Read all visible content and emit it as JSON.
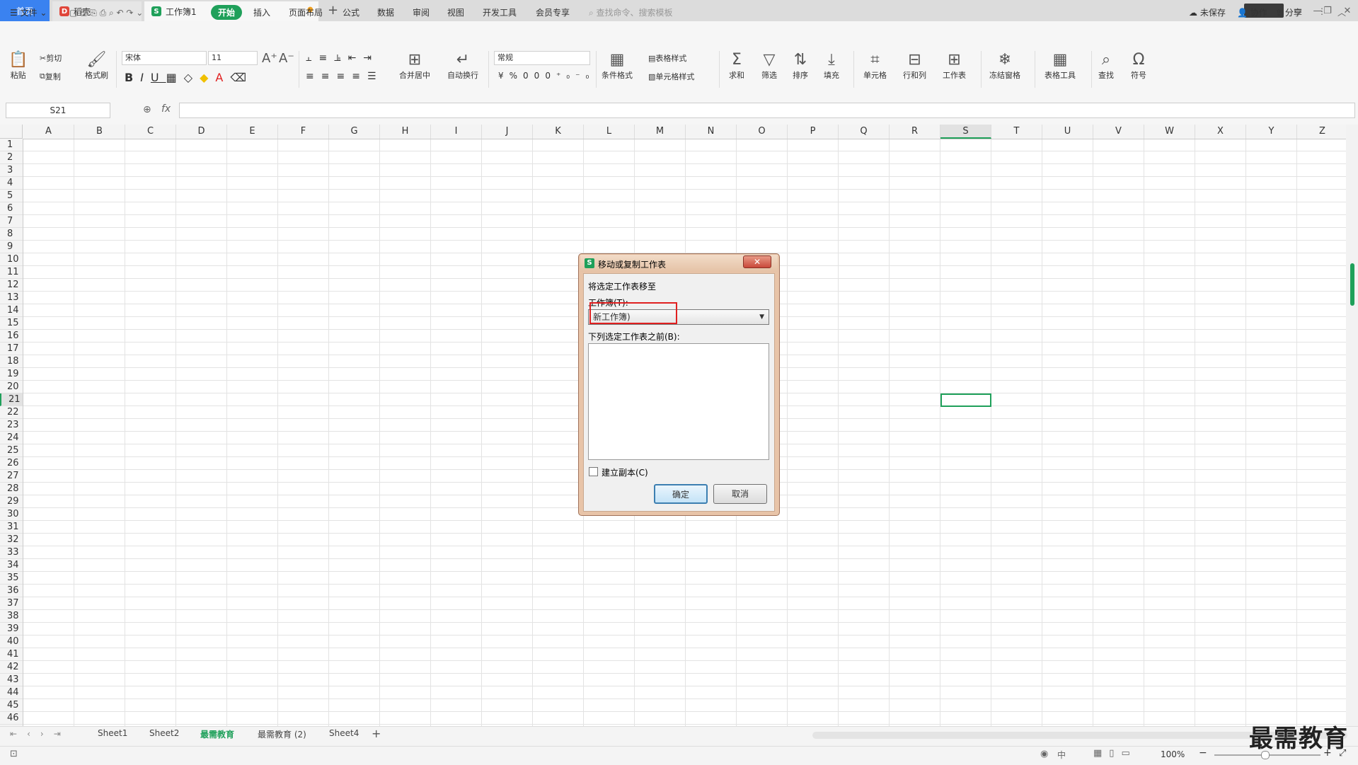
{
  "tabs": {
    "home": "首页",
    "daoke": "稻壳",
    "workbook": "工作簿1",
    "new_tab": "+"
  },
  "menu": {
    "file": "文件",
    "items": [
      "开始",
      "插入",
      "页面布局",
      "公式",
      "数据",
      "审阅",
      "视图",
      "开发工具",
      "会员专享"
    ],
    "search_placeholder": "查找命令、搜索模板",
    "right": [
      "未保存",
      "协作",
      "分享"
    ]
  },
  "ribbon": {
    "paste": "粘贴",
    "cut": "剪切",
    "copy": "复制",
    "format_painter": "格式刷",
    "font_name": "宋体",
    "font_size": "11",
    "merge_center": "合并居中",
    "wrap": "自动换行",
    "number_format": "常规",
    "cond_format": "条件格式",
    "table_style": "表格样式",
    "cell_style": "单元格样式",
    "sum": "求和",
    "filter": "筛选",
    "sort": "排序",
    "fill": "填充",
    "cell": "单元格",
    "row_col": "行和列",
    "sheet": "工作表",
    "freeze": "冻结窗格",
    "table_tools": "表格工具",
    "find": "查找",
    "symbol": "符号"
  },
  "formula_bar": {
    "name_box": "S21",
    "fx": "fx"
  },
  "columns": [
    "A",
    "B",
    "C",
    "D",
    "E",
    "F",
    "G",
    "H",
    "I",
    "J",
    "K",
    "L",
    "M",
    "N",
    "O",
    "P",
    "Q",
    "R",
    "S",
    "T",
    "U",
    "V",
    "W",
    "X",
    "Y",
    "Z"
  ],
  "rows": [
    "1",
    "2",
    "3",
    "4",
    "5",
    "6",
    "7",
    "8",
    "9",
    "10",
    "11",
    "12",
    "13",
    "14",
    "15",
    "16",
    "17",
    "18",
    "19",
    "20",
    "21",
    "22",
    "23",
    "24",
    "25",
    "26",
    "27",
    "28",
    "29",
    "30",
    "31",
    "32",
    "33",
    "34",
    "35",
    "36",
    "37",
    "38",
    "39",
    "40",
    "41",
    "42",
    "43",
    "44",
    "45",
    "46"
  ],
  "sheets": [
    "Sheet1",
    "Sheet2",
    "最需教育",
    "最需教育 (2)",
    "Sheet4"
  ],
  "status": {
    "zoom": "100%"
  },
  "dialog": {
    "title": "移动或复制工作表",
    "move_to": "将选定工作表移至",
    "workbook_label": "工作簿(T):",
    "workbook_value": "新工作簿)",
    "before_label": "下列选定工作表之前(B):",
    "copy_label": "建立副本(C)",
    "ok": "确定",
    "cancel": "取消"
  },
  "watermark": "最需教育",
  "colors": {
    "accent": "#1fa05a",
    "highlight": "#e02020"
  }
}
